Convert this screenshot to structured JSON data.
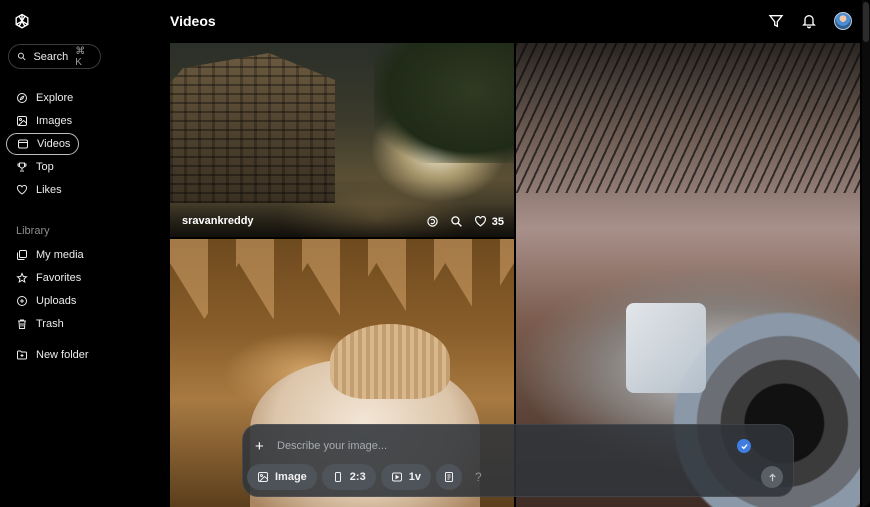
{
  "app": {
    "title": "Videos"
  },
  "search": {
    "label": "Search",
    "shortcut": "⌘ K"
  },
  "nav": [
    {
      "label": "Explore",
      "icon": "compass-icon"
    },
    {
      "label": "Images",
      "icon": "image-icon"
    },
    {
      "label": "Videos",
      "icon": "video-icon",
      "active": true
    },
    {
      "label": "Top",
      "icon": "trophy-icon"
    },
    {
      "label": "Likes",
      "icon": "heart-icon"
    }
  ],
  "library": {
    "heading": "Library",
    "items": [
      {
        "label": "My media",
        "icon": "media-icon"
      },
      {
        "label": "Favorites",
        "icon": "star-icon"
      },
      {
        "label": "Uploads",
        "icon": "upload-icon"
      },
      {
        "label": "Trash",
        "icon": "trash-icon"
      }
    ],
    "new_folder": "New folder"
  },
  "header": {
    "icons": [
      "filter-icon",
      "bell-icon",
      "avatar"
    ]
  },
  "gallery": {
    "tiles": [
      {
        "author": "sravankreddy",
        "likes": "35"
      },
      {
        "author": ""
      },
      {
        "author": ""
      }
    ]
  },
  "composer": {
    "placeholder": "Describe your image...",
    "chips": [
      {
        "label": "Image",
        "icon": "image-icon"
      },
      {
        "label": "2:3",
        "icon": "aspect-ratio-icon"
      },
      {
        "label": "1v",
        "icon": "video-icon"
      },
      {
        "label": "",
        "icon": "prompt-guide-icon"
      }
    ],
    "help": "?"
  },
  "colors": {
    "accent": "#3f7de0",
    "background": "#000000",
    "composer": "#30343a"
  }
}
